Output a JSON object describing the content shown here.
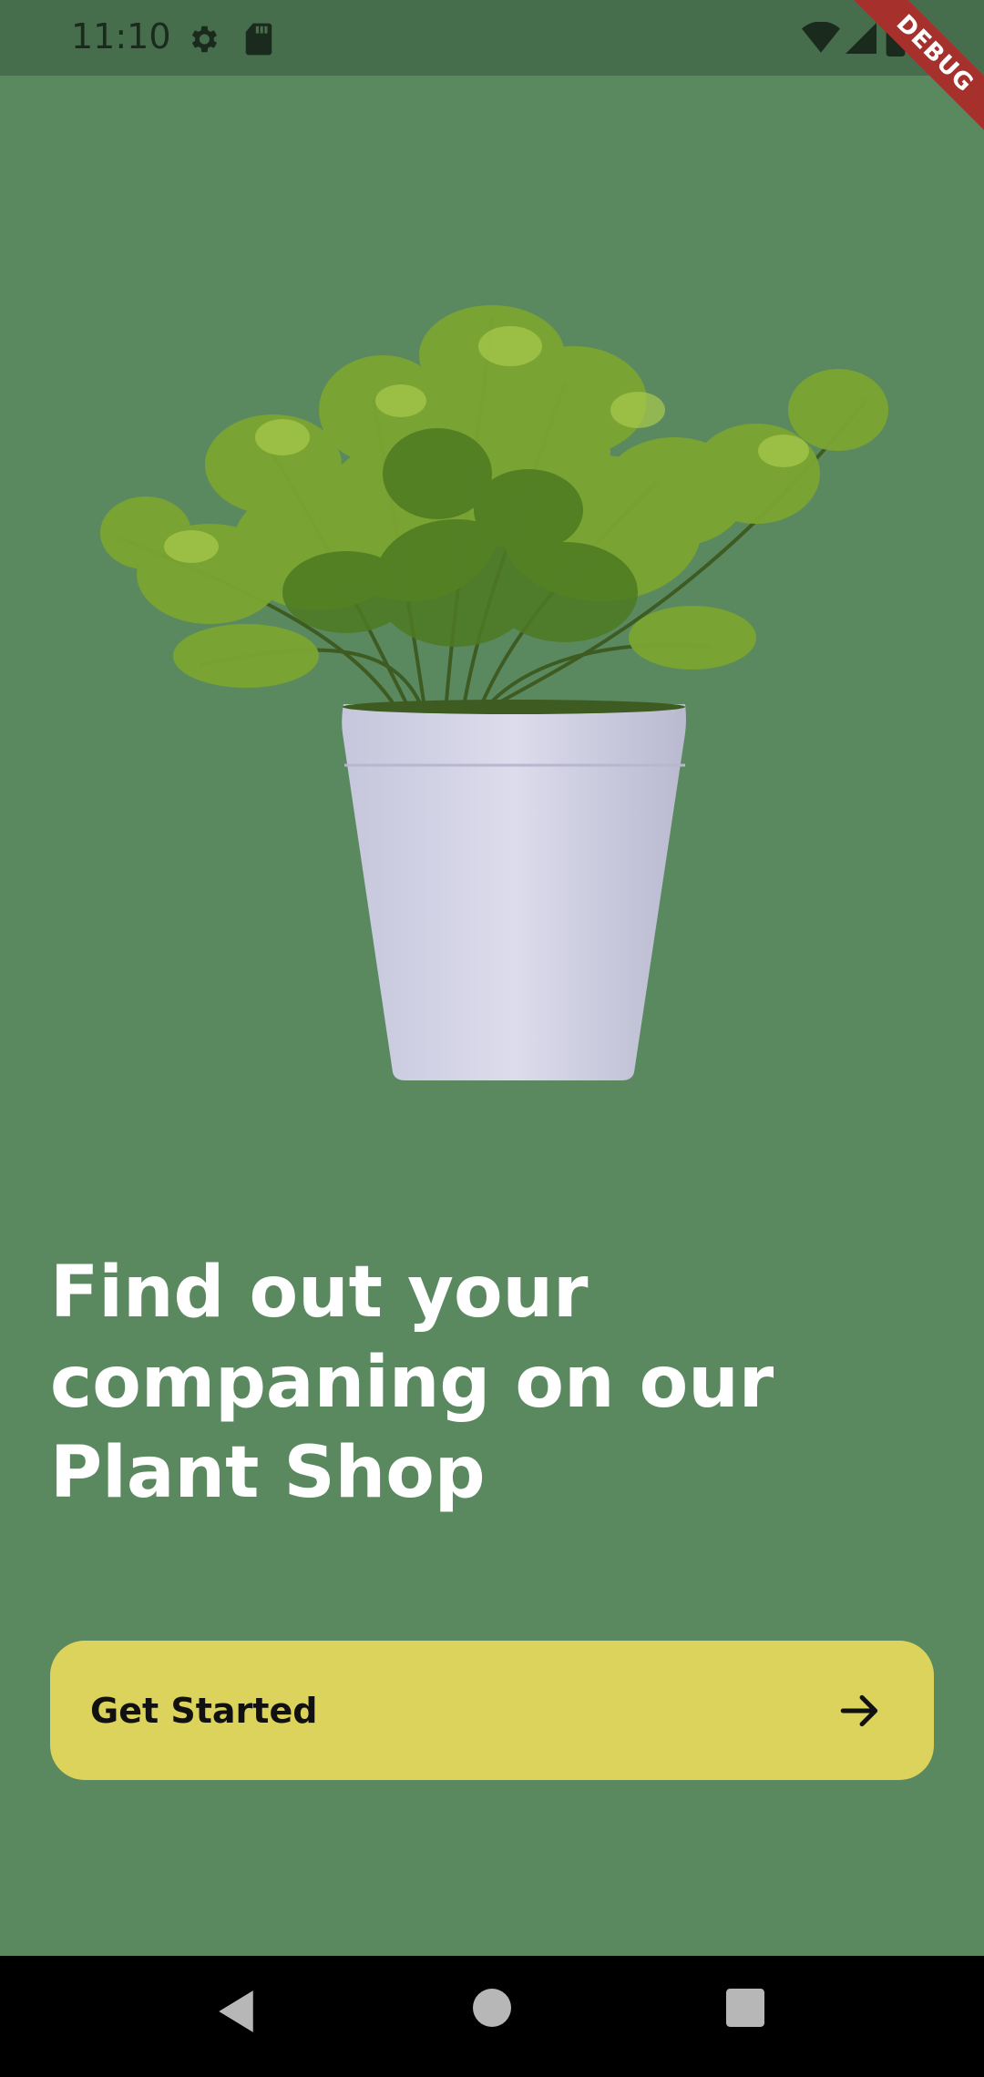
{
  "status_bar": {
    "time": "11:10",
    "icons": [
      "gear-icon",
      "sd-card-icon",
      "wifi-icon",
      "cell-signal-icon",
      "battery-icon"
    ]
  },
  "debug_banner": "DEBUG",
  "hero": {
    "image": "potted-plant-illustration"
  },
  "headline": "Find out your\ncompaning on our\nPlant Shop",
  "cta": {
    "label": "Get Started",
    "icon": "arrow-right-icon"
  },
  "nav_bar": {
    "buttons": [
      "back-icon",
      "home-icon",
      "recents-icon"
    ]
  },
  "colors": {
    "background": "#5a8960",
    "status_bar": "#466e4c",
    "button": "#dbd35b",
    "headline": "#ffffff",
    "debug_ribbon": "#a6302b"
  }
}
